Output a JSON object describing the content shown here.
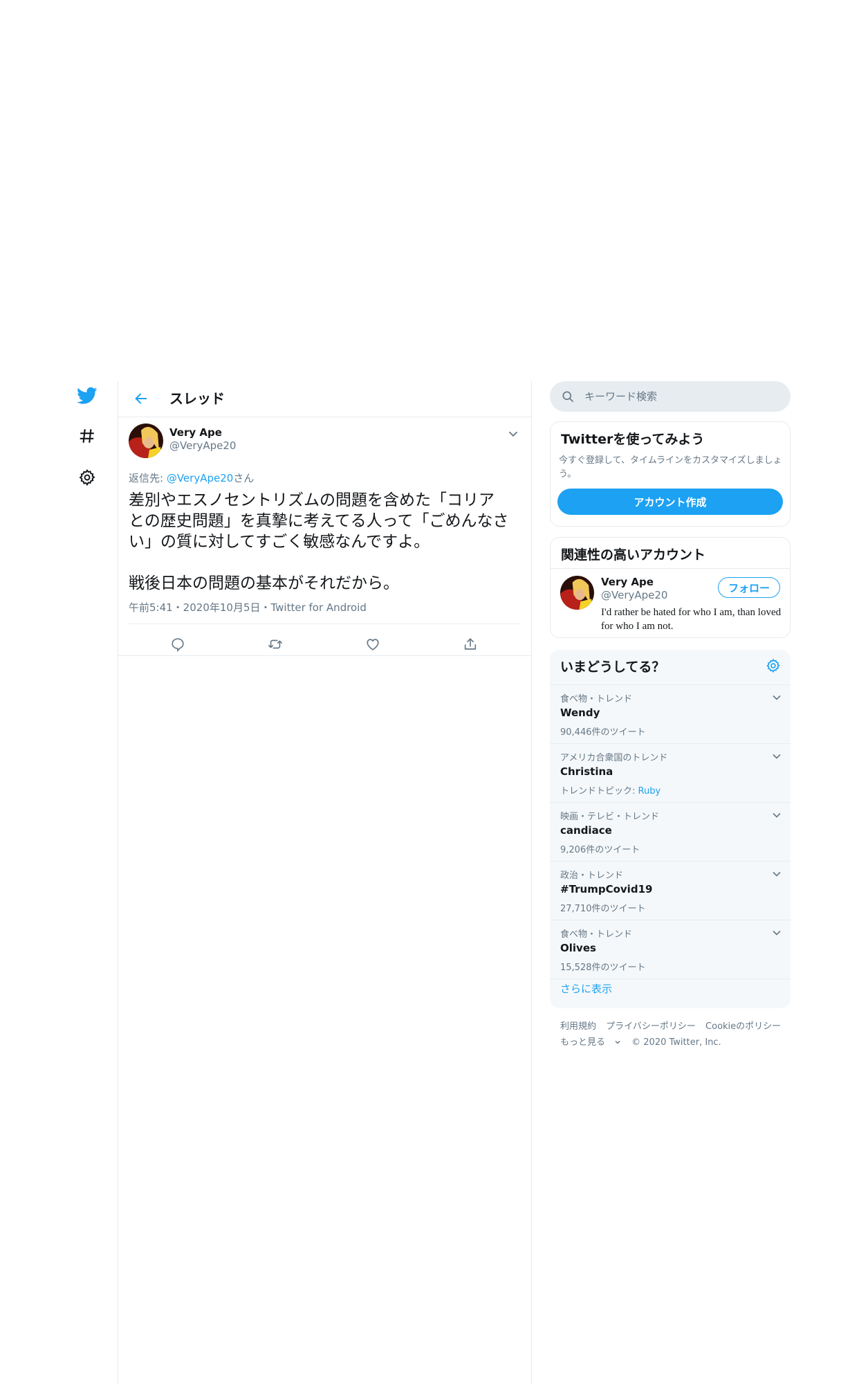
{
  "nav": {
    "items": [
      {
        "icon": "twitter-bird-icon"
      },
      {
        "icon": "hashtag-icon"
      },
      {
        "icon": "gear-icon"
      }
    ]
  },
  "header": {
    "title": "スレッド"
  },
  "tweet": {
    "name": "Very Ape",
    "handle": "@VeryApe20",
    "reply_prefix": "返信先: ",
    "reply_handle": "@VeryApe20",
    "reply_suffix": "さん",
    "text": "差別やエスノセントリズムの問題を含めた「コリア\nとの歴史問題」を真摯に考えてる人って「ごめんなさ\nい」の質に対してすごく敏感なんですよ。\n\n戦後日本の問題の基本がそれだから。",
    "meta": "午前5:41・2020年10月5日・Twitter for Android"
  },
  "search": {
    "placeholder": "キーワード検索"
  },
  "signup": {
    "title": "Twitterを使ってみよう",
    "desc": "今すぐ登録して、タイムラインをカスタマイズしましょう。",
    "button": "アカウント作成"
  },
  "related": {
    "title": "関連性の高いアカウント",
    "name": "Very Ape",
    "handle": "@VeryApe20",
    "follow": "フォロー",
    "bio": "I'd rather be hated for who I am, than loved for who I am not."
  },
  "trends": {
    "title": "いまどうしてる？",
    "items": [
      {
        "category": "食べ物・トレンド",
        "name": "Wendy",
        "sub": "90,446件のツイート",
        "topic": ""
      },
      {
        "category": "アメリカ合衆国のトレンド",
        "name": "Christina",
        "sub": "トレンドトピック: ",
        "topic": "Ruby"
      },
      {
        "category": "映画・テレビ・トレンド",
        "name": "candiace",
        "sub": "9,206件のツイート",
        "topic": ""
      },
      {
        "category": "政治・トレンド",
        "name": "#TrumpCovid19",
        "sub": "27,710件のツイート",
        "topic": ""
      },
      {
        "category": "食べ物・トレンド",
        "name": "Olives",
        "sub": "15,528件のツイート",
        "topic": ""
      }
    ],
    "show_more": "さらに表示"
  },
  "footer": {
    "terms": "利用規約",
    "privacy": "プライバシーポリシー",
    "cookie": "Cookieのポリシー",
    "more": "もっと見る",
    "copyright": "© 2020 Twitter, Inc."
  }
}
